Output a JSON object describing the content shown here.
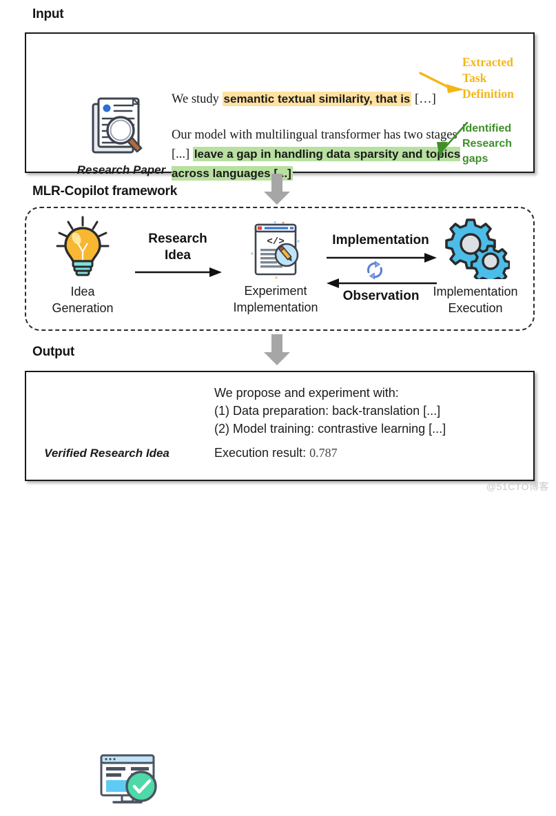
{
  "figure": {
    "watermark": "@51CTO博客"
  },
  "input": {
    "heading": "Input",
    "paper_caption": "Research Paper",
    "paper_icon": "research-paper-icon",
    "paragraph1": {
      "prefix": "We study ",
      "highlight": "semantic textual similarity, that is",
      "suffix": " […]"
    },
    "paragraph2": {
      "prefix": "Our model with multilingual transformer has two stages [...] ",
      "highlight": "leave a gap in handling data sparsity and topics  across languages [...]"
    },
    "annotations": [
      {
        "name": "extracted-task-definition",
        "text": "Extracted Task Definition",
        "color": "#f5b515",
        "arrow": "yellow-arrow-right"
      },
      {
        "name": "identified-research-gaps",
        "text": "Identified Research gaps",
        "color": "#3f8f2a",
        "arrow": "green-arrow-down-left"
      }
    ]
  },
  "framework": {
    "heading": "MLR-Copilot framework",
    "nodes": [
      {
        "icon": "lightbulb-icon",
        "label": "Idea\nGeneration"
      },
      {
        "icon": "code-document-pencil-icon",
        "label": "Experiment\nImplementation"
      },
      {
        "icon": "gears-icon",
        "label": "Implementation\nExecution"
      }
    ],
    "flows": [
      {
        "label": "Research\nIdea",
        "direction": "right"
      },
      {
        "label": "Implementation",
        "direction": "right"
      },
      {
        "label": "Observation",
        "direction": "left"
      }
    ],
    "loop_icon": "refresh-loop-icon"
  },
  "output": {
    "heading": "Output",
    "verified_caption": "Verified Research Idea",
    "verified_icon": "verified-research-idea-icon",
    "lines": [
      "We propose and experiment with:",
      "(1) Data preparation: back-translation [...]",
      "(2) Model training: contrastive learning [...]"
    ],
    "result_label": "Execution result: ",
    "result_value": "0.787"
  },
  "colors": {
    "highlight_yellow": "#ffe2a0",
    "highlight_green": "#b8e0a0",
    "annotation_yellow": "#f5b515",
    "annotation_green": "#3f8f2a",
    "arrow_grey": "#a6a6a6",
    "icon_blue": "#4bbde8",
    "icon_amber": "#f7b731",
    "icon_teal": "#4dd9a8"
  }
}
